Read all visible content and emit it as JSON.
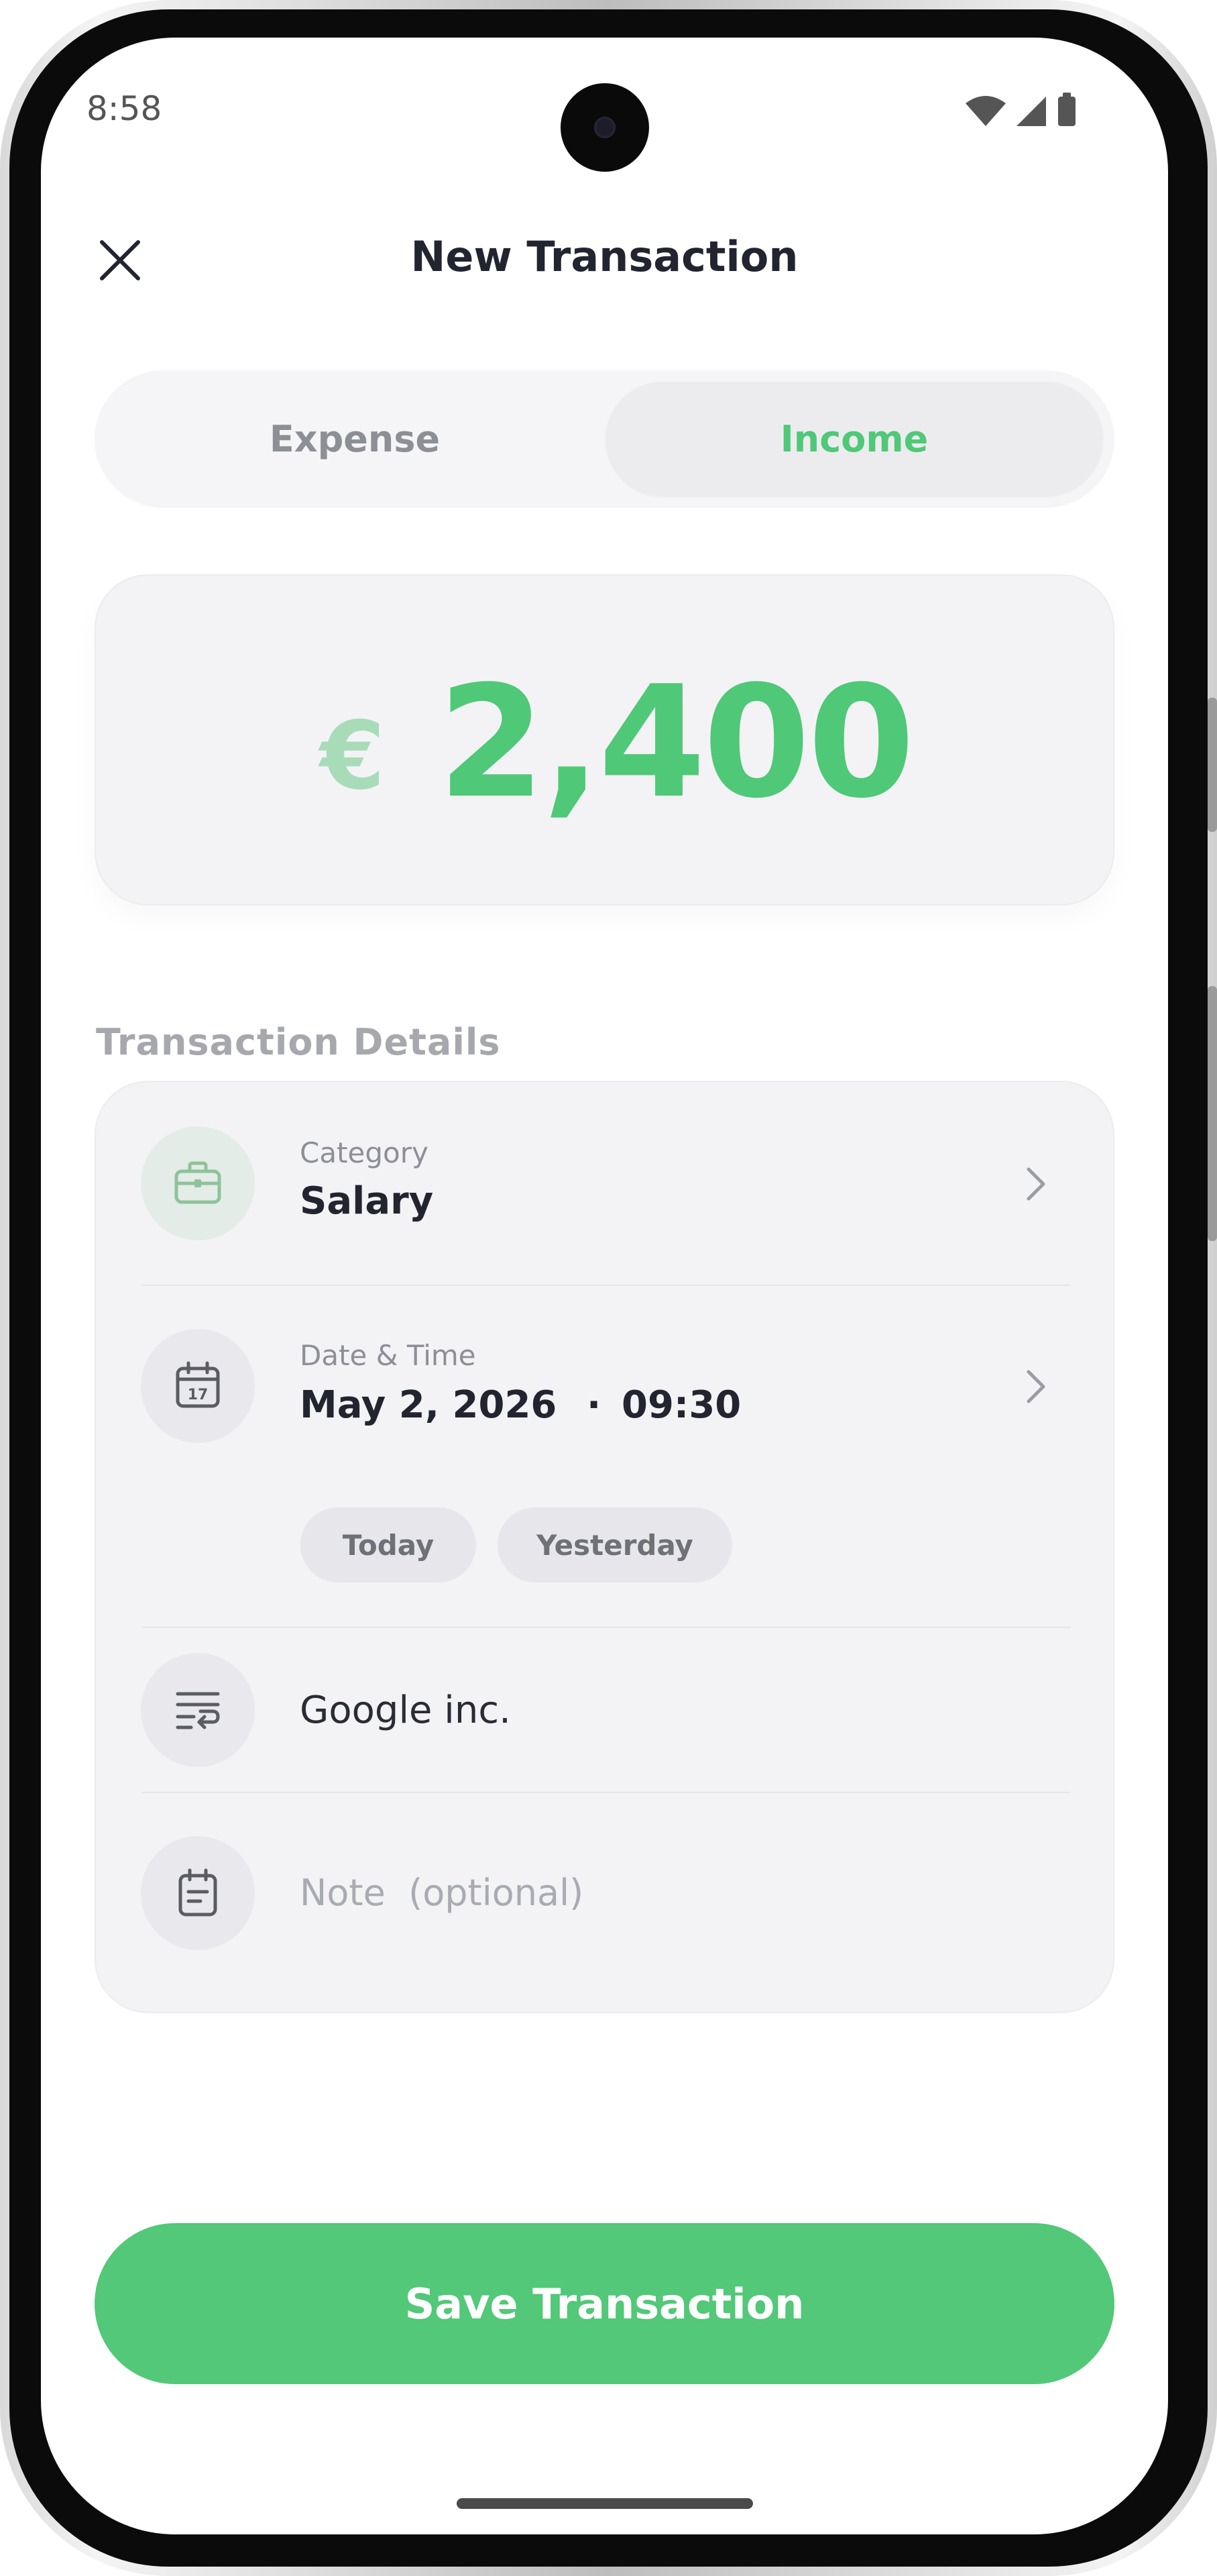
{
  "status_bar": {
    "time": "8:58",
    "icons": [
      "wifi-icon",
      "signal-icon",
      "battery-icon"
    ]
  },
  "header": {
    "close_icon": "close-icon",
    "title": "New Transaction"
  },
  "type_toggle": {
    "options": [
      "Expense",
      "Income"
    ],
    "selected": "Income"
  },
  "amount": {
    "currency": "€",
    "value": "2,400"
  },
  "details": {
    "section_title": "Transaction Details",
    "category": {
      "icon": "briefcase-icon",
      "label": "Category",
      "value": "Salary"
    },
    "date_time": {
      "icon": "calendar-icon",
      "label": "Date & Time",
      "date": "May 2, 2026",
      "separator": "·",
      "time": "09:30",
      "quick_options": [
        "Today",
        "Yesterday"
      ]
    },
    "payee": {
      "icon": "wrap-text-icon",
      "value": "Google inc."
    },
    "note": {
      "icon": "calendar-note-icon",
      "placeholder": "Note  (optional)"
    }
  },
  "actions": {
    "save_label": "Save Transaction"
  },
  "colors": {
    "accent": "#52c878",
    "amount_text": "#4fc878",
    "currency_text": "#a8dcb8",
    "title_text": "#222530",
    "muted_text": "#8d8f96",
    "card_bg": "#f3f3f6"
  }
}
